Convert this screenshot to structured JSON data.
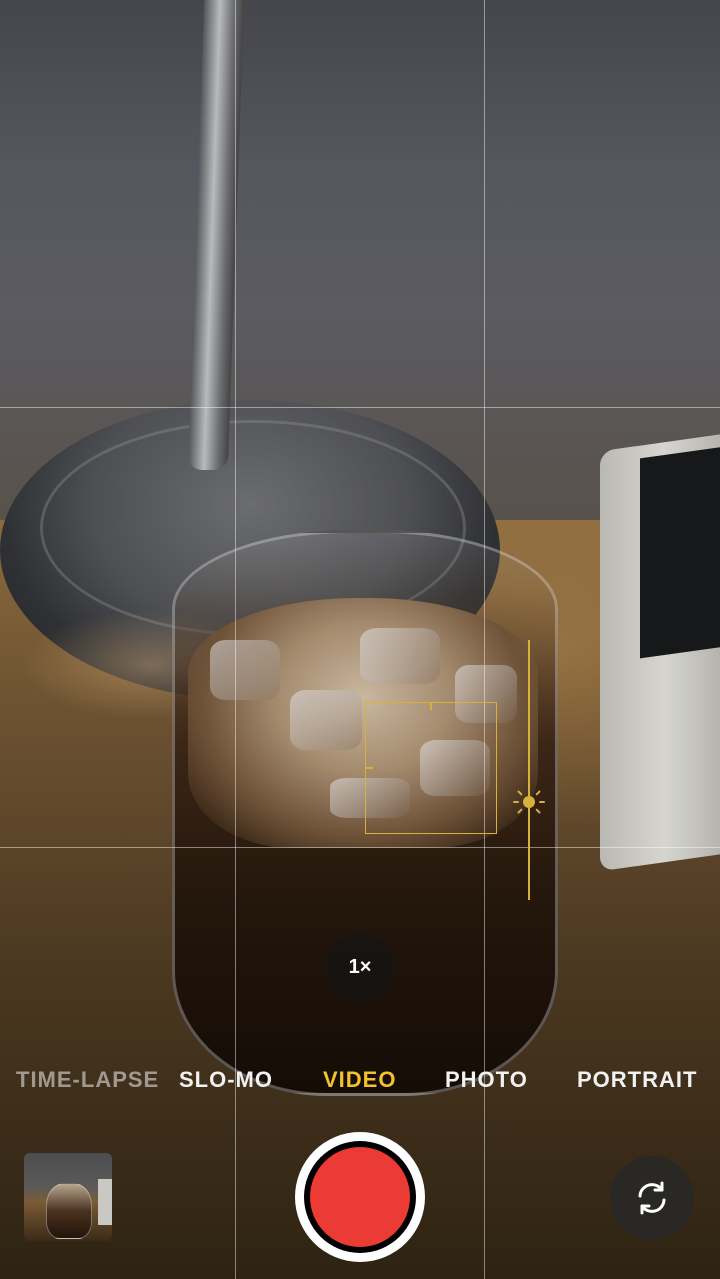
{
  "camera": {
    "zoom_label": "1×",
    "modes": [
      {
        "label": "TIME-LAPSE"
      },
      {
        "label": "SLO-MO"
      },
      {
        "label": "VIDEO",
        "active": true
      },
      {
        "label": "PHOTO"
      },
      {
        "label": "PORTRAIT"
      }
    ],
    "active_mode": "VIDEO",
    "accent_color": "#f3c12d",
    "record_color": "#ec3a35",
    "icons": [
      "sun-exposure-icon",
      "camera-flip-icon"
    ],
    "grid": "on"
  }
}
